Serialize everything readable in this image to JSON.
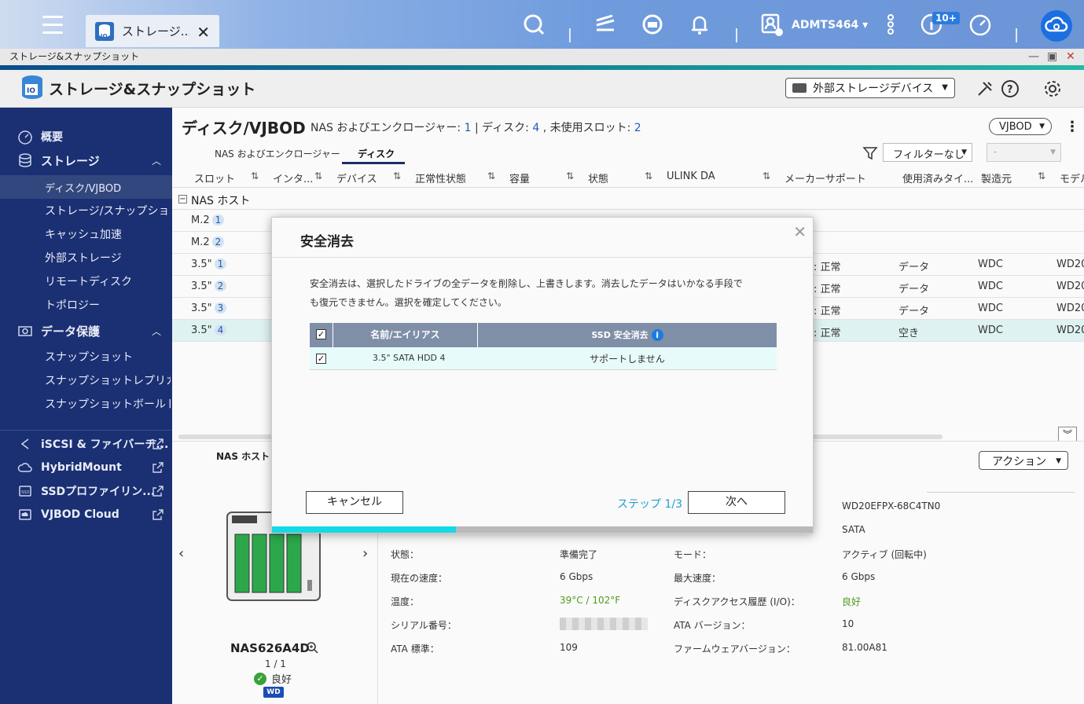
{
  "topbar": {
    "tab_label": "ストレージ...",
    "username": "ADMTS464",
    "notification_badge": "10+"
  },
  "window": {
    "title": "ストレージ&スナップショット"
  },
  "app": {
    "name": "ストレージ&スナップショット",
    "external_device_select": "外部ストレージデバイス"
  },
  "sidebar": {
    "items": [
      {
        "label": "概要"
      },
      {
        "label": "ストレージ"
      },
      {
        "label": "ディスク/VJBOD"
      },
      {
        "label": "ストレージ/スナップショ..."
      },
      {
        "label": "キャッシュ加速"
      },
      {
        "label": "外部ストレージ"
      },
      {
        "label": "リモートディスク"
      },
      {
        "label": "トポロジー"
      },
      {
        "label": "データ保護"
      },
      {
        "label": "スナップショット"
      },
      {
        "label": "スナップショットレプリカ"
      },
      {
        "label": "スナップショットボールト"
      },
      {
        "label": "iSCSI & ファイバーチ..."
      },
      {
        "label": "HybridMount"
      },
      {
        "label": "SSDプロファイリン..."
      },
      {
        "label": "VJBOD Cloud"
      }
    ]
  },
  "page": {
    "title": "ディスク/VJBOD",
    "summary_prefix": "NAS およびエンクロージャー:",
    "enclosure_count": "1",
    "disk_label": "| ディスク:",
    "disk_count": "4",
    "unused_label": ", 未使用スロット:",
    "unused_count": "2",
    "vjbod_button": "VJBOD",
    "tabs": [
      "NAS およびエンクロージャー",
      "ディスク"
    ],
    "filter_value": "フィルターなし",
    "filter2_value": "-"
  },
  "table": {
    "headers": [
      "スロット",
      "インタ...",
      "デバイス",
      "正常性状態",
      "容量",
      "状態",
      "ULINK DA",
      "メーカーサポート",
      "使用済みタイ...",
      "製造元",
      "モデル"
    ],
    "group": "NAS ホスト",
    "rows": [
      {
        "slot": "M.2",
        "num": "1",
        "status": "",
        "usage": "",
        "maker": "",
        "model": ""
      },
      {
        "slot": "M.2",
        "num": "2",
        "status": "",
        "usage": "",
        "maker": "",
        "model": ""
      },
      {
        "slot": "3.5\"",
        "num": "1",
        "status": ": 正常",
        "usage": "データ",
        "maker": "WDC",
        "model": "WD20"
      },
      {
        "slot": "3.5\"",
        "num": "2",
        "status": ": 正常",
        "usage": "データ",
        "maker": "WDC",
        "model": "WD20"
      },
      {
        "slot": "3.5\"",
        "num": "3",
        "status": ": 正常",
        "usage": "データ",
        "maker": "WDC",
        "model": "WD20"
      },
      {
        "slot": "3.5\"",
        "num": "4",
        "status": ": 正常",
        "usage": "空き",
        "maker": "WDC",
        "model": "WD20"
      }
    ]
  },
  "detail": {
    "nas_host": "NAS ホスト 1",
    "nas_model": "NAS626A4D",
    "page": "1 / 1",
    "health": "良好",
    "wd_logo": "WD",
    "action_button": "アクション",
    "model_value": "WD20EFPX-68C4TN0",
    "interface_value": "SATA",
    "fields": [
      {
        "k": "状態：",
        "v": "準備完了",
        "k2": "モード：",
        "v2": "アクティブ (回転中)"
      },
      {
        "k": "現在の速度：",
        "v": "6 Gbps",
        "k2": "最大速度：",
        "v2": "6 Gbps"
      },
      {
        "k": "温度：",
        "v": "39°C / 102°F",
        "k2": "ディスクアクセス履歴 (I/O)：",
        "v2": "良好"
      },
      {
        "k": "シリアル番号：",
        "v": "",
        "k2": "ATA バージョン：",
        "v2": "10"
      },
      {
        "k": "ATA 標準：",
        "v": "109",
        "k2": "ファームウェアバージョン：",
        "v2": "81.00A81"
      }
    ]
  },
  "modal": {
    "title": "安全消去",
    "description": "安全消去は、選択したドライブの全データを削除し、上書きします。消去したデータはいかなる手段でも復元できません。選択を確定してください。",
    "col_name": "名前/エイリアス",
    "col_ssd": "SSD 安全消去",
    "row_name": "3.5\" SATA HDD 4",
    "row_ssd": "サポートしません",
    "cancel": "キャンセル",
    "step": "ステップ 1/3",
    "next": "次へ",
    "progress_fraction": 0.34
  },
  "colors": {
    "sidebar": "#1b2f73",
    "accent": "#16d9e6",
    "link": "#1e9fd0"
  }
}
